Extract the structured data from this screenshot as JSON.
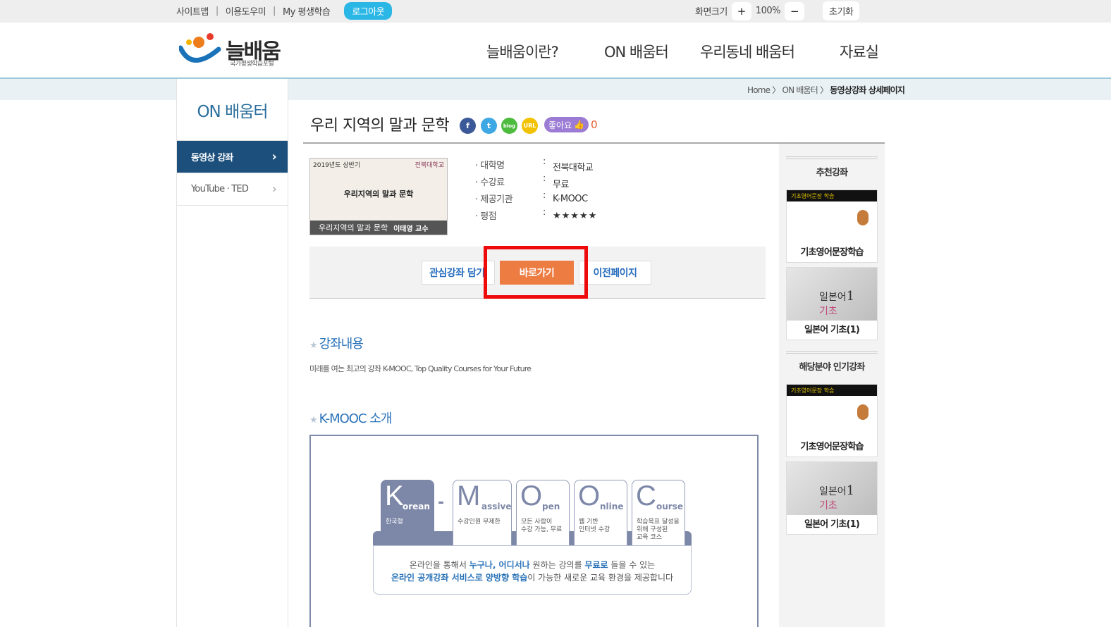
{
  "topbar": {
    "links": [
      "사이트맵",
      "이용도우미",
      "My 평생학습"
    ],
    "logout": "로그아웃",
    "zoom_label": "화면크기",
    "zoom_plus": "+",
    "zoom_value": "100%",
    "zoom_minus": "−",
    "reset": "초기화"
  },
  "logo": {
    "name": "늘배움",
    "sub": "국가평생학습포털"
  },
  "gnb": [
    "늘배움이란?",
    "ON 배움터",
    "우리동네 배움터",
    "자료실"
  ],
  "lnb": {
    "title": "ON 배움터",
    "items": [
      {
        "label": "동영상 강좌",
        "arrow": "›"
      },
      {
        "label": "YouTube · TED",
        "arrow": "›"
      }
    ]
  },
  "breadcrumb": {
    "home": "Home",
    "sep": "〉",
    "mid": "ON 배움터",
    "current": "동영상강좌 상세페이지"
  },
  "course": {
    "title": "우리 지역의 말과 문학",
    "sns": {
      "facebook": "f",
      "twitter": "t",
      "blog": "blog",
      "url": "URL"
    },
    "like_label": "좋아요",
    "like_icon": "👍",
    "like_count": "0",
    "thumb": {
      "year": "2019년도 상반기",
      "univ": "전북대학교",
      "mid": "우리지역의 말과 문학",
      "bar": "우리지역의 말과 문학",
      "prof": "이태영 교수"
    },
    "info": [
      {
        "key": "대학명",
        "colon": ":",
        "value": "전북대학교"
      },
      {
        "key": "수강료",
        "colon": ":",
        "value": "무료"
      },
      {
        "key": "제공기관",
        "colon": ":",
        "value": "K-MOOC"
      },
      {
        "key": "평점",
        "colon": ":",
        "value": "★★★★★"
      }
    ],
    "rating": 0
  },
  "actions": {
    "wish": "관심강좌 담기",
    "go": "바로가기",
    "prev": "이전페이지"
  },
  "section1": {
    "star": "★",
    "title": "강좌내용",
    "body": "미래를 여는 최고의 강좌 K-MOOC, Top Quality Courses for Your Future"
  },
  "section2": {
    "star": "★",
    "title": "K-MOOC 소개"
  },
  "kmooc": {
    "dash": "-",
    "cards": [
      {
        "big": "K",
        "small": "orean",
        "desc1": "한국형",
        "desc2": "",
        "desc3": ""
      },
      {
        "big": "M",
        "small": "assive",
        "desc1": "수강인원 무제한",
        "desc2": "",
        "desc3": ""
      },
      {
        "big": "O",
        "small": "pen",
        "desc1": "모든 사람이",
        "desc2": "수강 가능, 무료",
        "desc3": ""
      },
      {
        "big": "O",
        "small": "nline",
        "desc1": "웹 기반",
        "desc2": "인터넷 수강",
        "desc3": ""
      },
      {
        "big": "C",
        "small": "ourse",
        "desc1": "학습목표 달성을",
        "desc2": "위해 구성된",
        "desc3": "교육 코스"
      }
    ],
    "line1_a": "온라인을 통해서 ",
    "line1_b": "누구나, 어디서나",
    "line1_c": " 원하는 강의를 ",
    "line1_d": "무료로",
    "line1_e": " 들을 수 있는",
    "line2_a": "온라인 공개강좌 서비스로 양방향 학습",
    "line2_b": "이 가능한 새로운 교육 환경을 제공합니다"
  },
  "sidebar": {
    "rec_title": "추천강좌",
    "pop_title": "해당분야 인기강좌",
    "cards": [
      {
        "banner": "기초영어문장 학습",
        "caption": "기초영어문장학습"
      },
      {
        "jp_a": "일본어",
        "jp_b": "1",
        "jp_c": "기초",
        "caption": "일본어 기초(1)"
      },
      {
        "banner": "기초영어문장 학습",
        "caption": "기초영어문장학습"
      },
      {
        "jp_a": "일본어",
        "jp_b": "1",
        "jp_c": "기초",
        "caption": "일본어 기초(1)"
      }
    ]
  },
  "colors": {
    "accent": "#2bb7e6",
    "navy": "#1c4f7c",
    "go": "#ed7c43",
    "highlight": "#ee0a0a",
    "link": "#2a73b8"
  }
}
